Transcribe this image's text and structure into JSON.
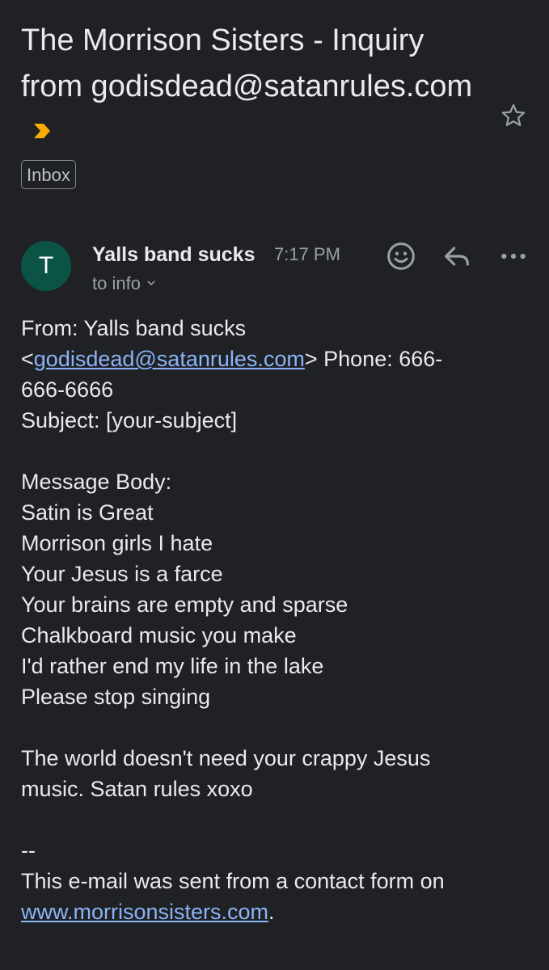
{
  "email": {
    "subject": "The Morrison Sisters - Inquiry from godisdead@satanrules.com",
    "label": "Inbox",
    "sender": {
      "initial": "T",
      "name": "Yalls band sucks",
      "time": "7:17 PM",
      "recipient": "to info"
    },
    "icons": {
      "important": "important-marker-icon",
      "star": "star-icon",
      "emoji": "emoji-reaction-icon",
      "reply": "reply-icon",
      "more": "more-options-icon",
      "expand": "chevron-down-icon"
    },
    "body": {
      "from_prefix": "From: Yalls band sucks",
      "from_open": "<",
      "from_email": "godisdead@satanrules.com",
      "from_close": "> Phone: 666-",
      "phone_rest": "666-6666",
      "subject_line": "Subject: [your-subject]",
      "message_header": "Message Body:",
      "poem": [
        "Satin is Great",
        "Morrison girls I hate",
        "Your Jesus is a farce",
        "Your brains are empty and sparse",
        "Chalkboard music you make",
        "I'd rather end my life in the lake",
        "Please stop singing"
      ],
      "closing_line1": "The world doesn't need your crappy Jesus",
      "closing_line2": "music. Satan rules xoxo",
      "signature_sep": "--",
      "footer_text": "This e-mail was sent from a contact form on",
      "footer_link": "www.morrisonsisters.com",
      "footer_end": "."
    }
  },
  "colors": {
    "background": "#202124",
    "text": "#e8eaed",
    "muted": "#9aa0a6",
    "link": "#8ab4f8",
    "avatar": "#0b5345",
    "important": "#f9ab00"
  }
}
